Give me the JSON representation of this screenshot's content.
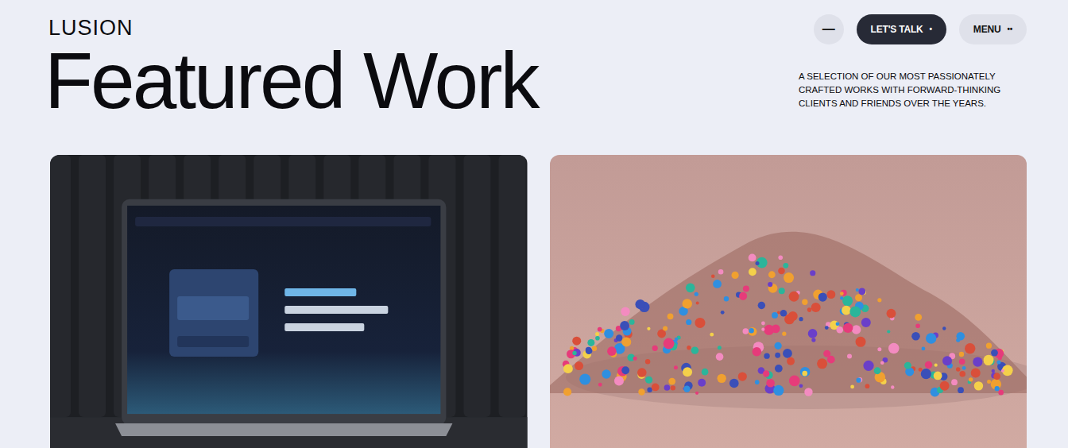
{
  "brand": "LUSION",
  "title": "Featured Work",
  "nav": {
    "minimize": "—",
    "cta": {
      "label": "LET'S TALK",
      "dot": "•"
    },
    "menu": {
      "label": "MENU",
      "dots": "••"
    }
  },
  "intro": "A SELECTION OF OUR MOST PASSIONATELY CRAFTED WORKS WITH FORWARD-THINKING CLIENTS AND FRIENDS OVER THE YEARS.",
  "projects": [
    {
      "kind": "laptop"
    },
    {
      "kind": "flowers"
    }
  ]
}
